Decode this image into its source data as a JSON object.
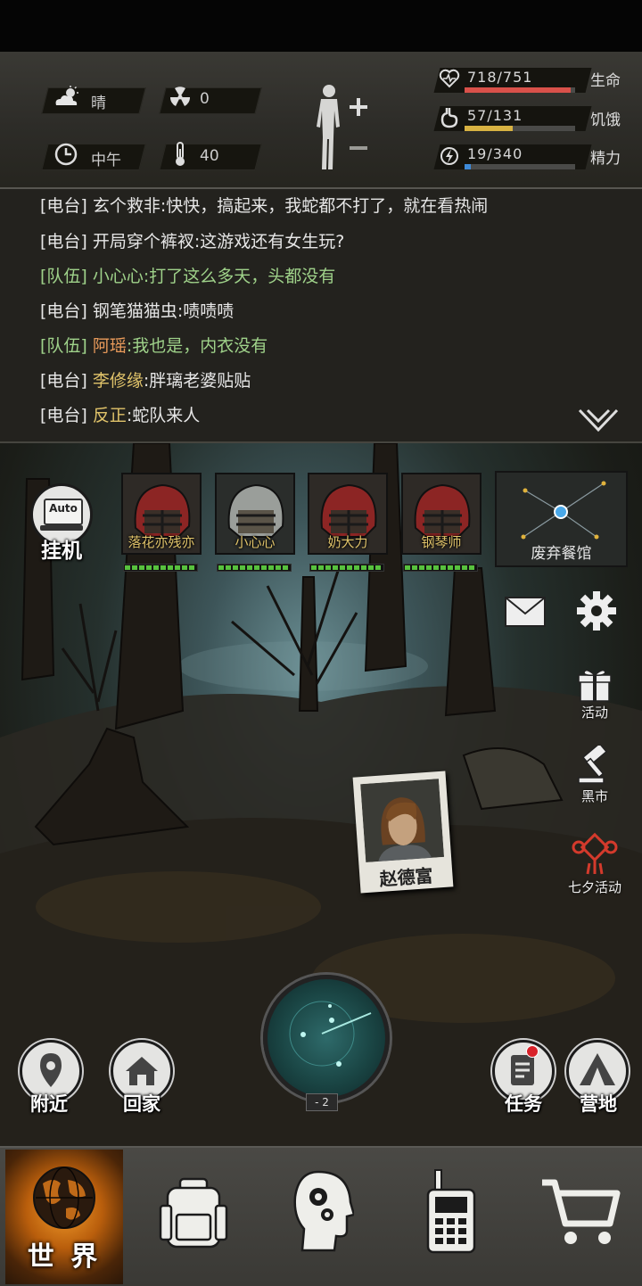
{
  "stats": {
    "weather": "晴",
    "radiation": "0",
    "time_of_day": "中午",
    "temperature": "40",
    "health": {
      "value": "718/751",
      "label": "生命",
      "fraction": 0.956,
      "color": "#d9514a"
    },
    "hunger": {
      "value": "57/131",
      "label": "饥饿",
      "fraction": 0.435,
      "color": "#d8b242"
    },
    "energy": {
      "value": "19/340",
      "label": "精力",
      "fraction": 0.056,
      "color": "#3e8ad8"
    }
  },
  "chat": {
    "messages": [
      {
        "tag": "[电台]",
        "kind": "radio",
        "name": "玄个救非",
        "text": ":快快，搞起来，我蛇都不打了，就在看热闹"
      },
      {
        "tag": "[电台]",
        "kind": "radio",
        "name": "开局穿个裤衩",
        "text": ":这游戏还有女生玩?"
      },
      {
        "tag": "[队伍]",
        "kind": "team",
        "name": "小心心",
        "text": ":打了这么多天，头都没有"
      },
      {
        "tag": "[电台]",
        "kind": "radio",
        "name": "钢笔猫猫虫",
        "text": ":啧啧啧"
      },
      {
        "tag": "[队伍]",
        "kind": "team",
        "name": "阿瑶",
        "text": ":我也是，内衣没有"
      },
      {
        "tag": "[电台]",
        "kind": "radio",
        "name": "李修缘",
        "text": ":胖璃老婆贴贴"
      },
      {
        "tag": "[电台]",
        "kind": "radio",
        "name": "反正",
        "text": ":蛇队来人"
      }
    ]
  },
  "auto": {
    "icon_text": "Auto",
    "label": "挂机"
  },
  "party": [
    {
      "name": "落花亦残亦",
      "helmet": "red",
      "hp": 1.0
    },
    {
      "name": "小心心",
      "helmet": "grey",
      "hp": 1.0
    },
    {
      "name": "奶大力",
      "helmet": "red",
      "hp": 1.0
    },
    {
      "name": "钢琴师",
      "helmet": "red",
      "hp": 1.0
    }
  ],
  "location": {
    "name": "废弃餐馆"
  },
  "side_menu": {
    "activity": "活动",
    "black_market": "黑市",
    "qixi": "七夕活动"
  },
  "npc": {
    "name": "赵德富"
  },
  "radar": {
    "level": "- 2"
  },
  "actions": {
    "nearby": "附近",
    "home": "回家",
    "tasks": "任务",
    "camp": "营地"
  },
  "nav": {
    "world": "世 界"
  },
  "icons": [
    "weather-icon",
    "radiation-icon",
    "clock-icon",
    "thermometer-icon",
    "heart-icon",
    "stomach-icon",
    "energy-icon",
    "mail-icon",
    "gear-icon",
    "gift-icon",
    "hammer-icon",
    "knot-icon",
    "backpack-icon",
    "head-gears-icon",
    "walkie-talkie-icon",
    "cart-icon"
  ]
}
